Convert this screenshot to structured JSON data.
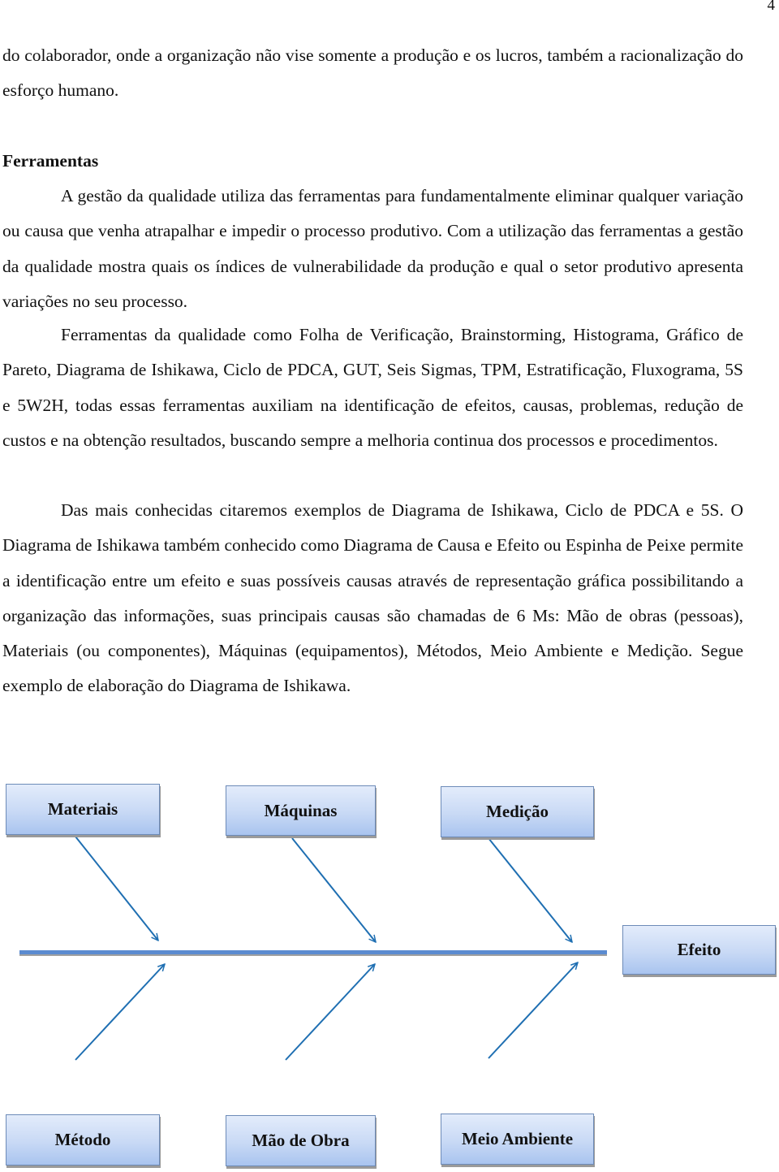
{
  "page_number": "4",
  "paragraphs": {
    "intro": "do colaborador, onde a organização não vise somente a produção e os lucros, também a racionalização do esforço humano.",
    "heading": "Ferramentas",
    "p1": "A gestão da qualidade utiliza das ferramentas para fundamentalmente eliminar qualquer variação ou causa que venha atrapalhar e impedir o processo produtivo. Com a utilização das ferramentas a gestão da qualidade mostra quais os índices de vulnerabilidade da produção e qual o setor produtivo apresenta variações no seu processo.",
    "p2": "Ferramentas da qualidade como Folha de Verificação, Brainstorming, Histograma, Gráfico de Pareto, Diagrama de Ishikawa, Ciclo de PDCA, GUT, Seis Sigmas, TPM, Estratificação, Fluxograma, 5S e 5W2H, todas essas ferramentas auxiliam na identificação de efeitos, causas, problemas, redução de custos e na obtenção resultados, buscando sempre a melhoria continua dos processos e procedimentos.",
    "p3": "Das mais conhecidas citaremos exemplos de Diagrama de Ishikawa, Ciclo de PDCA e 5S. O Diagrama de Ishikawa também conhecido como Diagrama de Causa e Efeito ou Espinha de Peixe permite a identificação entre um efeito e suas possíveis causas através de representação gráfica possibilitando a organização das informações, suas principais causas são chamadas de 6 Ms: Mão de obras (pessoas), Materiais (ou componentes), Máquinas (equipamentos), Métodos, Meio Ambiente e Medição. Segue exemplo de elaboração do Diagrama de Ishikawa."
  },
  "diagram": {
    "type": "ishikawa",
    "effect": "Efeito",
    "top_causes": [
      "Materiais",
      "Máquinas",
      "Medição"
    ],
    "bottom_causes": [
      "Método",
      "Mão de Obra",
      "Meio Ambiente"
    ],
    "colors": {
      "arrow": "#1f6fb2",
      "spine": "#5b8bd0",
      "box_border": "#6d8bb8",
      "box_fill_top": "#e3ecfb",
      "box_fill_bottom": "#a9c4ef"
    }
  }
}
